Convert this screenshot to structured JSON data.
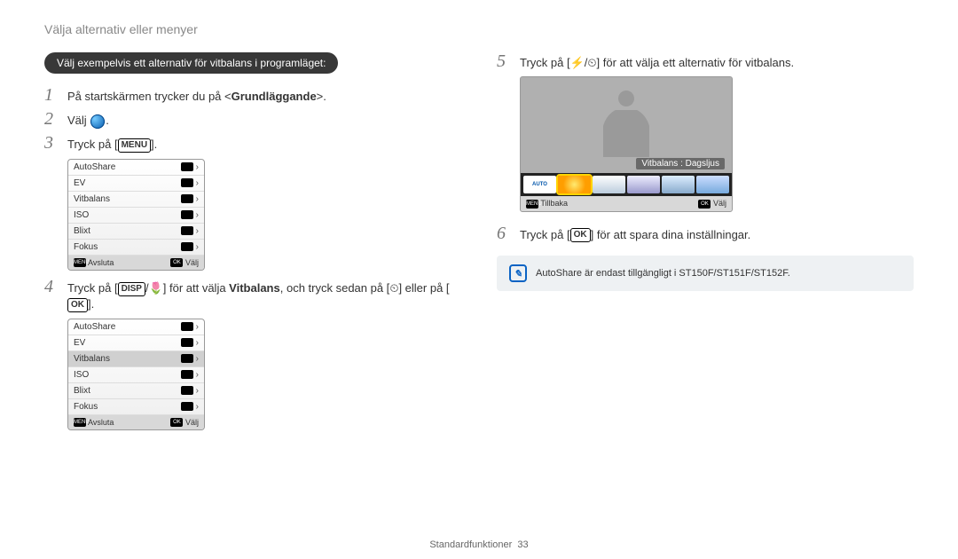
{
  "header": "Välja alternativ eller menyer",
  "pill": "Välj exempelvis ett alternativ för vitbalans i programläget:",
  "steps": {
    "s1": {
      "num": "1",
      "pre": "På startskärmen trycker du på <",
      "bold": "Grundläggande",
      "post": ">."
    },
    "s2": {
      "num": "2",
      "text": "Välj "
    },
    "s3": {
      "num": "3",
      "text": "Tryck på [",
      "key": "MENU",
      "post": "]."
    },
    "s4": {
      "num": "4",
      "pre": "Tryck på [",
      "k1": "DISP",
      "mid1": "/",
      "macro": "🌷",
      "mid2": "] för att välja ",
      "bold": "Vitbalans",
      "post1": ", och tryck sedan på [",
      "timer": "⏲",
      "post2": "] eller på [",
      "k2": "OK",
      "post3": "]."
    },
    "s5": {
      "num": "5",
      "pre": "Tryck på [",
      "flash": "⚡",
      "mid": "/",
      "timer": "⏲",
      "post": "] för att välja ett alternativ för vitbalans."
    },
    "s6": {
      "num": "6",
      "pre": "Tryck på [",
      "key": "OK",
      "post": "] för att spara dina inställningar."
    }
  },
  "menu": {
    "items": [
      {
        "label": "AutoShare"
      },
      {
        "label": "EV"
      },
      {
        "label": "Vitbalans"
      },
      {
        "label": "ISO"
      },
      {
        "label": "Blixt"
      },
      {
        "label": "Fokus"
      }
    ],
    "foot_left_key": "MENU",
    "foot_left": "Avsluta",
    "foot_right_key": "OK",
    "foot_right": "Välj"
  },
  "preview": {
    "wb_label": "Vitbalans : Dagsljus",
    "auto": "AUTO",
    "foot_left_key": "MENU",
    "foot_left": "Tillbaka",
    "foot_right_key": "OK",
    "foot_right": "Välj"
  },
  "info": "AutoShare är endast tillgängligt i ST150F/ST151F/ST152F.",
  "footer": {
    "label": "Standardfunktioner",
    "page": "33"
  }
}
